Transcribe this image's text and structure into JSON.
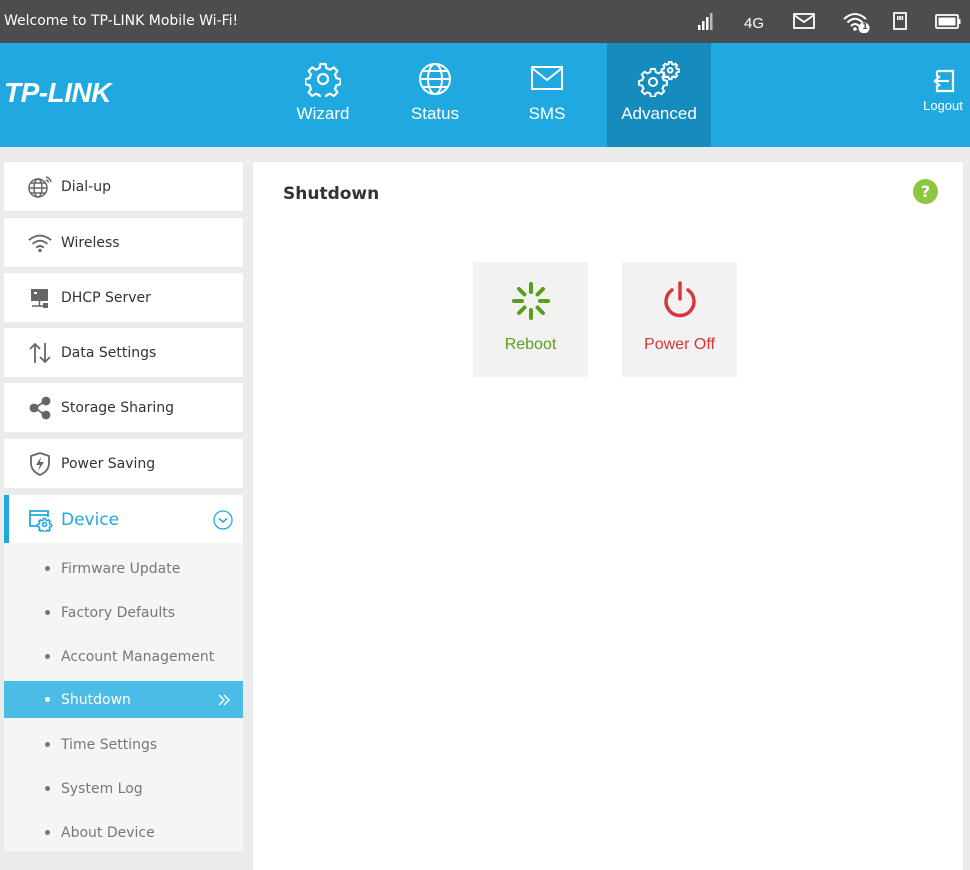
{
  "topbar": {
    "welcome": "Welcome to TP-LINK Mobile Wi-Fi!",
    "network_type": "4G",
    "wifi_clients": "1",
    "indicators": [
      "signal-icon",
      "mail-icon",
      "wifi-icon",
      "sim-icon",
      "battery-icon"
    ]
  },
  "header": {
    "logo": "TP-LINK",
    "nav": [
      {
        "label": "Wizard",
        "icon": "gear-icon"
      },
      {
        "label": "Status",
        "icon": "globe-icon"
      },
      {
        "label": "SMS",
        "icon": "envelope-icon"
      },
      {
        "label": "Advanced",
        "icon": "gears-icon",
        "active": true
      }
    ],
    "logout": "Logout"
  },
  "sidebar": {
    "items": [
      {
        "label": "Dial-up",
        "icon": "globe-dialup-icon"
      },
      {
        "label": "Wireless",
        "icon": "wifi-icon"
      },
      {
        "label": "DHCP Server",
        "icon": "server-icon"
      },
      {
        "label": "Data Settings",
        "icon": "arrows-updown-icon"
      },
      {
        "label": "Storage Sharing",
        "icon": "share-icon"
      },
      {
        "label": "Power Saving",
        "icon": "shield-bolt-icon"
      },
      {
        "label": "Device",
        "icon": "device-gear-icon",
        "expanded": true
      }
    ],
    "device_sub": [
      {
        "label": "Firmware Update"
      },
      {
        "label": "Factory Defaults"
      },
      {
        "label": "Account Management"
      },
      {
        "label": "Shutdown",
        "active": true
      },
      {
        "label": "Time Settings"
      },
      {
        "label": "System Log"
      },
      {
        "label": "About Device"
      }
    ]
  },
  "main": {
    "title": "Shutdown",
    "help": "?",
    "reboot_label": "Reboot",
    "poweroff_label": "Power Off"
  },
  "colors": {
    "accent": "#1fa9e0",
    "accent_dark": "#168bbd",
    "reboot_green": "#5a9e1b",
    "poweroff_red": "#d9363b",
    "help_green": "#8dc63f"
  }
}
